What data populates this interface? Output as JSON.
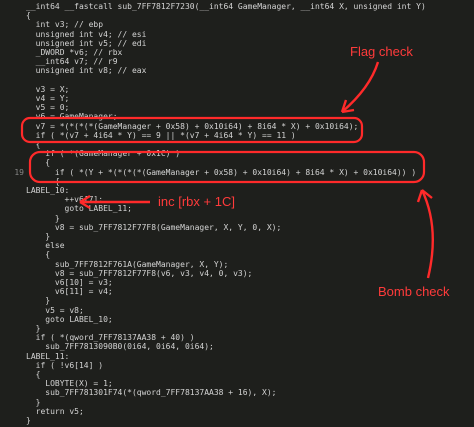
{
  "code_lines": [
    {
      "ln": "",
      "text": "__int64 __fastcall sub_7FF7812F7230(__int64 GameManager, __int64 X, unsigned int Y)"
    },
    {
      "ln": "",
      "text": "{"
    },
    {
      "ln": "",
      "text": "  int v3; // ebp"
    },
    {
      "ln": "",
      "text": "  unsigned int v4; // esi"
    },
    {
      "ln": "",
      "text": "  unsigned int v5; // edi"
    },
    {
      "ln": "",
      "text": "  _DWORD *v6; // rbx"
    },
    {
      "ln": "",
      "text": "  __int64 v7; // r9"
    },
    {
      "ln": "",
      "text": "  unsigned int v8; // eax"
    },
    {
      "ln": "",
      "text": ""
    },
    {
      "ln": "",
      "text": "  v3 = X;"
    },
    {
      "ln": "",
      "text": "  v4 = Y;"
    },
    {
      "ln": "",
      "text": "  v5 = 0;"
    },
    {
      "ln": "",
      "text": "  v6 = GameManager;"
    },
    {
      "ln": "",
      "text": "  v7 = *(*(*(*(GameManager + 0x58) + 0x10i64) + 8i64 * X) + 0x10i64);"
    },
    {
      "ln": "",
      "text": "  if ( *(v7 + 4i64 * Y) == 9 || *(v7 + 4i64 * Y) == 11 )"
    },
    {
      "ln": "",
      "text": "  {"
    },
    {
      "ln": "",
      "text": "    if ( *(GameManager + 0x1C) )"
    },
    {
      "ln": "",
      "text": "    {"
    },
    {
      "ln": "19",
      "text": "      if ( *(Y + *(*(*(*(GameManager + 0x58) + 0x10i64) + 8i64 * X) + 0x10i64)) )"
    },
    {
      "ln": "",
      "text": "      {"
    },
    {
      "ln": "",
      "text": "LABEL_10:"
    },
    {
      "ln": "",
      "text": "        ++v6[7];"
    },
    {
      "ln": "",
      "text": "        goto LABEL_11;"
    },
    {
      "ln": "",
      "text": "      }"
    },
    {
      "ln": "",
      "text": "      v8 = sub_7FF7812F77F8(GameManager, X, Y, 0, X);"
    },
    {
      "ln": "",
      "text": "    }"
    },
    {
      "ln": "",
      "text": "    else"
    },
    {
      "ln": "",
      "text": "    {"
    },
    {
      "ln": "",
      "text": "      sub_7FF7812F761A(GameManager, X, Y);"
    },
    {
      "ln": "",
      "text": "      v8 = sub_7FF7812F77F8(v6, v3, v4, 0, v3);"
    },
    {
      "ln": "",
      "text": "      v6[10] = v3;"
    },
    {
      "ln": "",
      "text": "      v6[11] = v4;"
    },
    {
      "ln": "",
      "text": "    }"
    },
    {
      "ln": "",
      "text": "    v5 = v8;"
    },
    {
      "ln": "",
      "text": "    goto LABEL_10;"
    },
    {
      "ln": "",
      "text": "  }"
    },
    {
      "ln": "",
      "text": "  if ( *(qword_7FF78137AA38 + 40) )"
    },
    {
      "ln": "",
      "text": "    sub_7FF7813090B0(0i64, 0i64, 0i64);"
    },
    {
      "ln": "",
      "text": "LABEL_11:"
    },
    {
      "ln": "",
      "text": "  if ( !v6[14] )"
    },
    {
      "ln": "",
      "text": "  {"
    },
    {
      "ln": "",
      "text": "    LOBYTE(X) = 1;"
    },
    {
      "ln": "",
      "text": "    sub_7FF781301F74(*(qword_7FF78137AA38 + 16), X);"
    },
    {
      "ln": "",
      "text": "  }"
    },
    {
      "ln": "",
      "text": "  return v5;"
    },
    {
      "ln": "",
      "text": "}"
    }
  ],
  "annotations": {
    "flag_check": "Flag check",
    "inc": "inc [rbx + 1C]",
    "bomb_check": "Bomb check"
  },
  "colors": {
    "background": "#1e1f1c",
    "annotation": "#ff2a2a",
    "code_text": "#d4d4d4",
    "highlight": "#f2c94c"
  }
}
